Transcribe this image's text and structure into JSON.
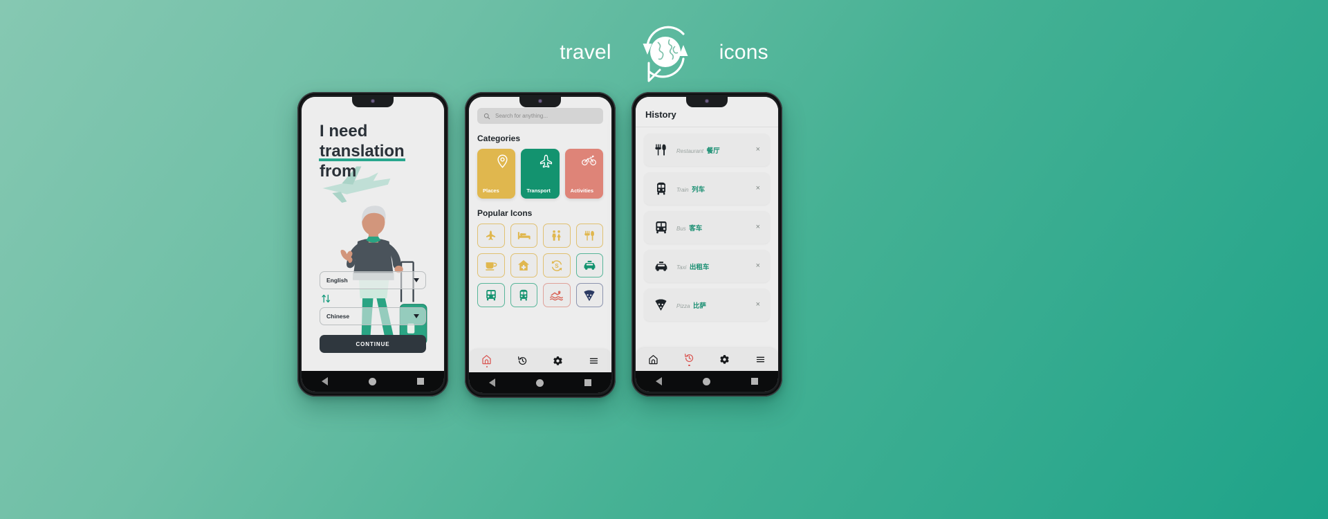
{
  "header": {
    "word_left": "travel",
    "word_right": "icons",
    "logo_icon": "globe-speech-bubble-refresh-icon"
  },
  "theme": {
    "bg_start": "#86c8b2",
    "bg_end": "#1ea389",
    "accent_green": "#1ea389",
    "accent_amber": "#e0b74e",
    "accent_coral": "#de8478",
    "accent_navy": "#2f373e",
    "active_nav": "#d9534f"
  },
  "phone1": {
    "title_line1": "I need",
    "title_underlined": "translation",
    "title_line3": "from",
    "source_language": "English",
    "target_language": "Chinese",
    "swap_icon": "swap-vertical-arrows-icon",
    "continue_label": "CONTINUE",
    "illustration": "traveler-with-suitcase-illustration"
  },
  "phone2": {
    "search_placeholder": "Search for anything...",
    "search_icon": "search-icon",
    "categories_title": "Categories",
    "categories": [
      {
        "label": "Places",
        "icon": "map-pin-icon",
        "color": "#e0b74e"
      },
      {
        "label": "Transport",
        "icon": "airplane-icon",
        "color": "#13936f"
      },
      {
        "label": "Activities",
        "icon": "bicycle-icon",
        "color": "#de8478"
      }
    ],
    "popular_title": "Popular Icons",
    "popular_icons": [
      {
        "name": "airplane-icon",
        "color": "#e0b74e"
      },
      {
        "name": "hotel-bed-icon",
        "color": "#e0b74e"
      },
      {
        "name": "restroom-icon",
        "color": "#e0b74e"
      },
      {
        "name": "restaurant-icon",
        "color": "#e0b74e"
      },
      {
        "name": "coffee-cup-icon",
        "color": "#e0b74e"
      },
      {
        "name": "hospital-icon",
        "color": "#e0b74e"
      },
      {
        "name": "currency-exchange-icon",
        "color": "#e0b74e"
      },
      {
        "name": "taxi-icon",
        "color": "#13936f"
      },
      {
        "name": "bus-icon",
        "color": "#13936f"
      },
      {
        "name": "train-icon",
        "color": "#13936f"
      },
      {
        "name": "swimming-icon",
        "color": "#d9695c"
      },
      {
        "name": "pizza-icon",
        "color": "#2b3a63"
      }
    ],
    "bottom_nav": [
      {
        "icon": "home-icon",
        "active": true
      },
      {
        "icon": "history-icon",
        "active": false
      },
      {
        "icon": "settings-gear-icon",
        "active": false
      },
      {
        "icon": "menu-hamburger-icon",
        "active": false
      }
    ]
  },
  "phone3": {
    "title": "History",
    "items": [
      {
        "en": "Restaurant",
        "zh": "餐厅",
        "icon": "restaurant-icon",
        "close": "×"
      },
      {
        "en": "Train",
        "zh": "列车",
        "icon": "train-icon",
        "close": "×"
      },
      {
        "en": "Bus",
        "zh": "客车",
        "icon": "bus-icon",
        "close": "×"
      },
      {
        "en": "Taxi",
        "zh": "出租车",
        "icon": "taxi-icon",
        "close": "×"
      },
      {
        "en": "Pizza",
        "zh": "比萨",
        "icon": "pizza-icon",
        "close": "×"
      }
    ],
    "bottom_nav": [
      {
        "icon": "home-icon",
        "active": false
      },
      {
        "icon": "history-icon",
        "active": true
      },
      {
        "icon": "settings-gear-icon",
        "active": false
      },
      {
        "icon": "menu-hamburger-icon",
        "active": false
      }
    ]
  },
  "system_nav": {
    "back": "back-triangle-icon",
    "home": "home-circle-icon",
    "recents": "recents-square-icon"
  }
}
